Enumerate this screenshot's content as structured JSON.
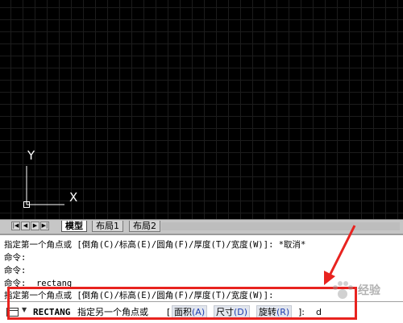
{
  "drawing_area": {
    "ucs_axes": {
      "x_label": "X",
      "y_label": "Y"
    }
  },
  "layout_tabs": {
    "nav_buttons": [
      "|◀",
      "◀",
      "▶",
      "▶|"
    ],
    "tabs": [
      {
        "label": "模型",
        "active": true
      },
      {
        "label": "布局1",
        "active": false
      },
      {
        "label": "布局2",
        "active": false
      }
    ]
  },
  "command_history": [
    "指定第一个角点或 [倒角(C)/标高(E)/圆角(F)/厚度(T)/宽度(W)]: *取消*",
    "命令:",
    "命令:",
    "命令:  rectang",
    "指定第一个角点或 [倒角(C)/标高(E)/圆角(F)/厚度(T)/宽度(W)]:"
  ],
  "command_line": {
    "command": "RECTANG",
    "prompt": "指定另一个角点或",
    "bracket_open": "[",
    "options": [
      {
        "label": "面积",
        "key": "(A)"
      },
      {
        "label": "尺寸",
        "key": "(D)"
      },
      {
        "label": "旋转",
        "key": "(R)"
      }
    ],
    "bracket_close": "]:",
    "input_value": "d"
  },
  "annotation": {
    "color": "#e8231f"
  },
  "watermark": {
    "text": "经验"
  }
}
